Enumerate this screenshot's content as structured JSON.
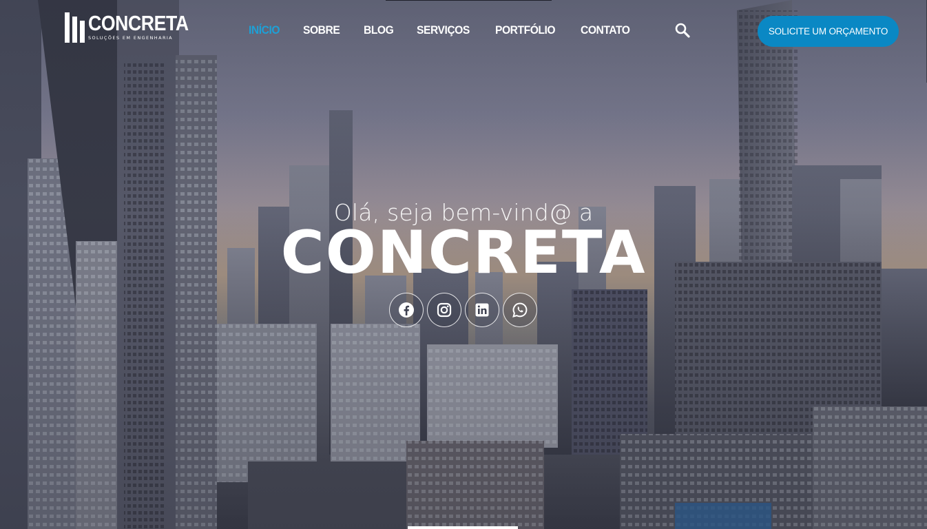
{
  "logo": {
    "name": "CONCRETA",
    "tagline": "SOLUÇÕES EM ENGENHARIA"
  },
  "nav": {
    "items": [
      {
        "label": "INÍCIO",
        "active": true
      },
      {
        "label": "SOBRE",
        "active": false
      },
      {
        "label": "BLOG",
        "active": false
      },
      {
        "label": "SERVIÇOS",
        "active": false
      },
      {
        "label": "PORTFÓLIO",
        "active": false
      },
      {
        "label": "CONTATO",
        "active": false
      }
    ],
    "search_icon": "search-icon"
  },
  "cta": {
    "label": "SOLICITE UM ORÇAMENTO"
  },
  "hero": {
    "greeting": "Olá, seja bem-vind@ a",
    "brand": "CONCRETA",
    "social": [
      {
        "icon": "facebook-icon"
      },
      {
        "icon": "instagram-icon"
      },
      {
        "icon": "linkedin-icon"
      },
      {
        "icon": "whatsapp-icon"
      }
    ]
  },
  "colors": {
    "accent": "#1ea0d6",
    "button": "#0a88c4",
    "text": "#ffffff"
  }
}
